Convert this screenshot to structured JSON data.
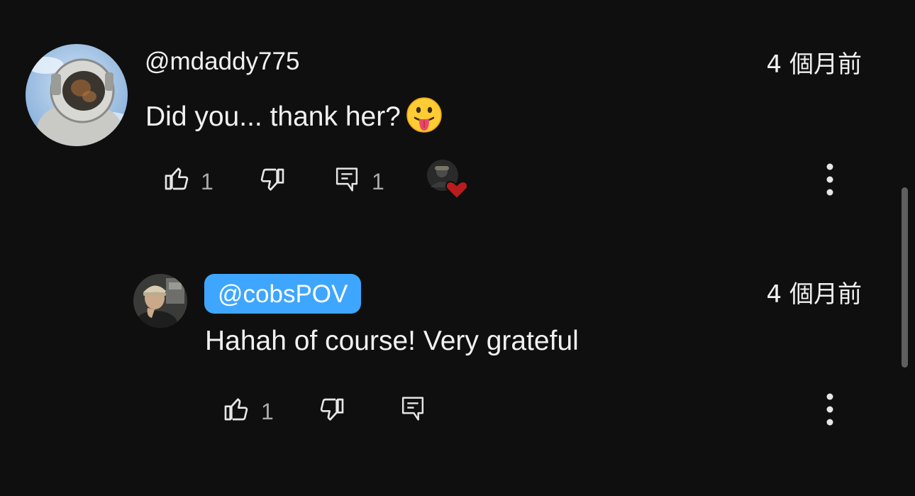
{
  "comment": {
    "author": "@mdaddy775",
    "time": "4 個月前",
    "text": "Did you... thank her?",
    "emoji_icon": "face-with-tongue-emoji",
    "likes": "1",
    "replies": "1",
    "hearted": true
  },
  "reply": {
    "author": "@cobsPOV",
    "time": "4 個月前",
    "text": "Hahah of course! Very grateful",
    "likes": "1",
    "author_highlight_color": "#3ea6ff"
  },
  "icons": {
    "like": "thumbs-up-icon",
    "dislike": "thumbs-down-icon",
    "reply": "reply-comment-icon",
    "more": "more-vertical-icon",
    "heart": "creator-heart-icon"
  }
}
